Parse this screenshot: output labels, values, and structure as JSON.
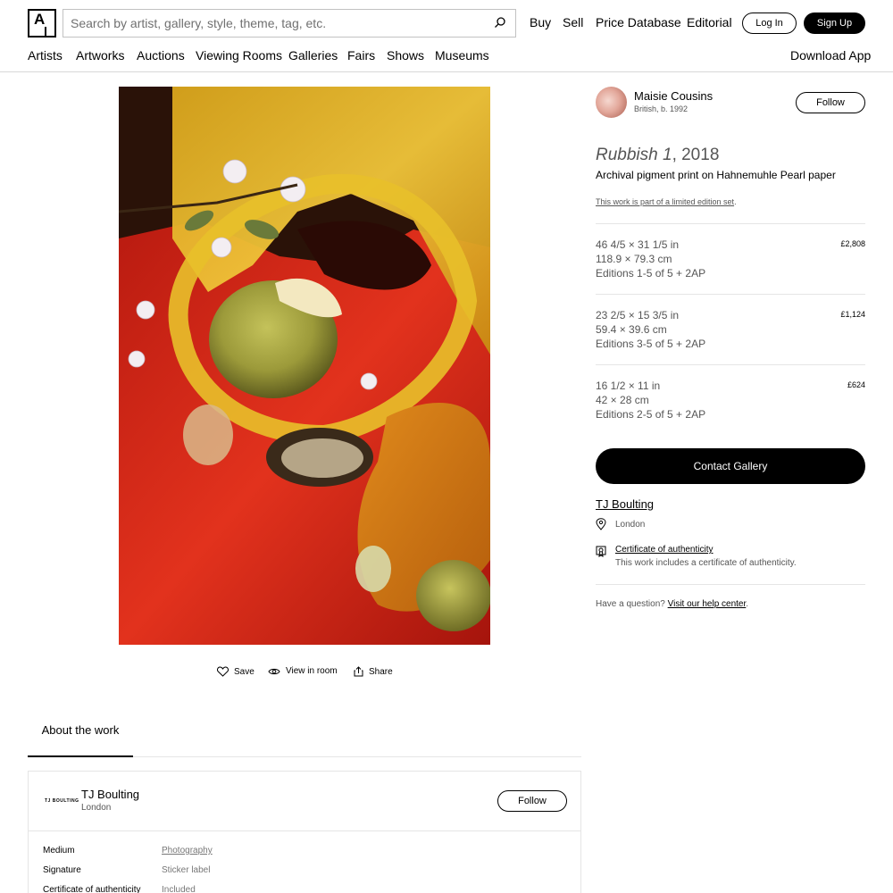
{
  "header": {
    "logo_letter": "A",
    "search_placeholder": "Search by artist, gallery, style, theme, tag, etc.",
    "nav": [
      "Buy",
      "Sell",
      "Price Database",
      "Editorial"
    ],
    "login_label": "Log In",
    "signup_label": "Sign Up"
  },
  "subnav": {
    "items": [
      "Artists",
      "Artworks",
      "Auctions",
      "Viewing Rooms",
      "Galleries",
      "Fairs",
      "Shows",
      "Museums"
    ],
    "download_label": "Download App"
  },
  "artwork_actions": {
    "save": "Save",
    "view_in_room": "View in room",
    "share": "Share"
  },
  "artist": {
    "name": "Maisie Cousins",
    "bio": "British, b. 1992",
    "follow_label": "Follow"
  },
  "work": {
    "title": "Rubbish 1",
    "year": ", 2018",
    "medium": "Archival pigment print on Hahnemuhle Pearl paper",
    "edition_note_link": "This work is part of a limited edition set",
    "edition_note_end": "."
  },
  "editions": [
    {
      "in": "46 4/5 × 31 1/5 in",
      "cm": "118.9 × 79.3 cm",
      "ed": "Editions 1-5 of 5 + 2AP",
      "price": "£2,808"
    },
    {
      "in": "23 2/5 × 15 3/5 in",
      "cm": "59.4 × 39.6 cm",
      "ed": "Editions 3-5 of 5 + 2AP",
      "price": "£1,124"
    },
    {
      "in": "16 1/2 × 11 in",
      "cm": "42 × 28 cm",
      "ed": "Editions 2-5 of 5 + 2AP",
      "price": "£624"
    }
  ],
  "gallery": {
    "contact_label": "Contact Gallery",
    "name": "TJ Boulting",
    "location": "London",
    "cert_title": "Certificate of authenticity",
    "cert_desc": "This work includes a certificate of authenticity.",
    "help_prefix": "Have a question? ",
    "help_link": "Visit our help center",
    "help_suffix": "."
  },
  "about": {
    "tab_label": "About the work",
    "card_logo": "TJ BOULTING",
    "card_name": "TJ Boulting",
    "card_loc": "London",
    "card_follow": "Follow",
    "specs": [
      {
        "label": "Medium",
        "value": "Photography"
      },
      {
        "label": "Signature",
        "value": "Sticker label"
      },
      {
        "label": "Certificate of authenticity",
        "value": "Included"
      }
    ]
  },
  "icons": {
    "search": "search-icon",
    "save": "heart-icon",
    "view": "eye-icon",
    "share": "share-icon",
    "location": "location-pin-icon",
    "certificate": "certificate-icon"
  }
}
